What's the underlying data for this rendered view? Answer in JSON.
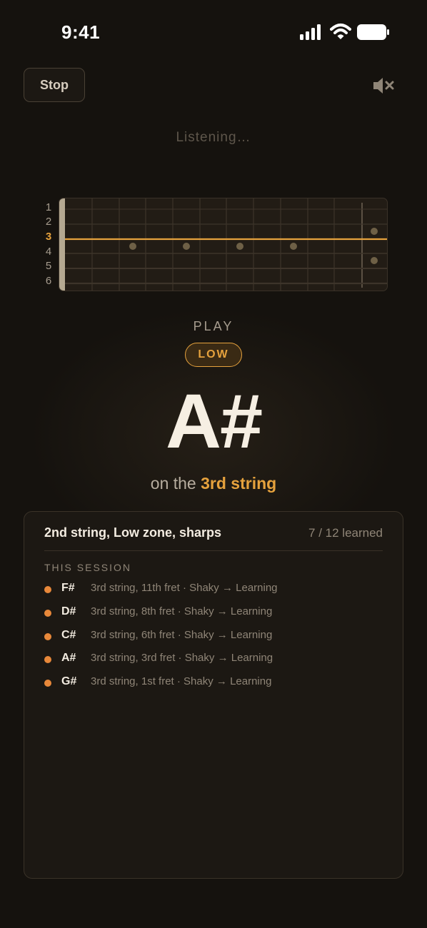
{
  "status_bar": {
    "time": "9:41",
    "icons": [
      "cellular-signal-icon",
      "wifi-icon",
      "battery-icon"
    ]
  },
  "controls": {
    "stop_label": "Stop",
    "mute_icon": "speaker-muted-icon"
  },
  "listening_text": "Listening…",
  "fretboard": {
    "string_labels": [
      "1",
      "2",
      "3",
      "4",
      "5",
      "6"
    ],
    "active_string": "3"
  },
  "prompt": {
    "play_label": "PLAY",
    "zone_badge": "LOW",
    "note": "A#",
    "on_the": "on the",
    "string": "3rd string"
  },
  "session_card": {
    "title": "2nd string, Low zone, sharps",
    "progress": "7 / 12 learned",
    "heading": "THIS SESSION",
    "items": [
      {
        "note": "F#",
        "detail": "3rd string, 11th fret · Shaky → Learning"
      },
      {
        "note": "D#",
        "detail": "3rd string, 8th fret · Shaky → Learning"
      },
      {
        "note": "C#",
        "detail": "3rd string, 6th fret · Shaky → Learning"
      },
      {
        "note": "A#",
        "detail": "3rd string, 3rd fret · Shaky → Learning"
      },
      {
        "note": "G#",
        "detail": "3rd string, 1st fret · Shaky → Learning"
      }
    ]
  },
  "colors": {
    "accent": "#e6a23d",
    "dot": "#e8883a",
    "background": "#15120e"
  }
}
